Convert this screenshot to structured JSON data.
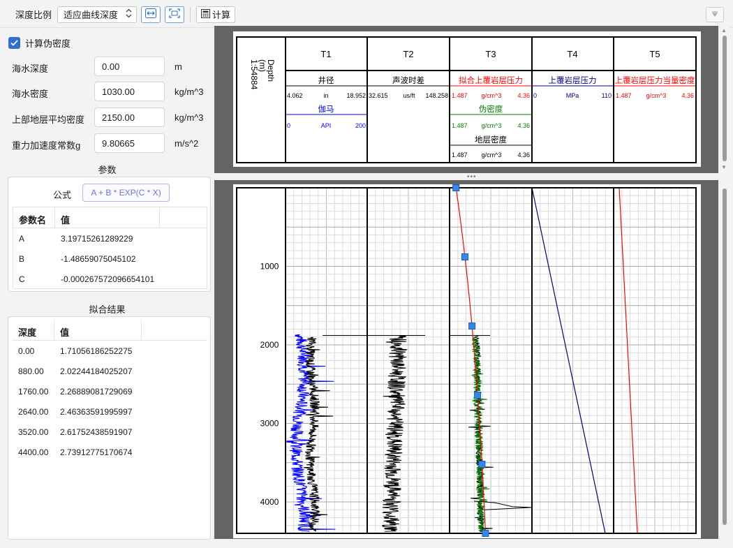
{
  "toolbar": {
    "depth_ratio_label": "深度比例",
    "depth_mode_value": "适应曲线深度",
    "fit_width_icon": "fit-width-icon",
    "fit-all-icon": "fit-all-icon",
    "calc_label": "计算",
    "calc_icon": "calculator-icon",
    "collapse_icon": "triangle-down-icon"
  },
  "settings": {
    "calc_pseudo_density_label": "计算伪密度",
    "calc_pseudo_density_checked": true,
    "fields": [
      {
        "label": "海水深度",
        "value": "0.00",
        "unit": "m"
      },
      {
        "label": "海水密度",
        "value": "1030.00",
        "unit": "kg/m^3"
      },
      {
        "label": "上部地层平均密度",
        "value": "2150.00",
        "unit": "kg/m^3"
      },
      {
        "label": "重力加速度常数g",
        "value": "9.80665",
        "unit": "m/s^2"
      }
    ]
  },
  "params": {
    "section_title": "参数",
    "formula_label": "公式",
    "formula_value": "A + B * EXP(C * X)",
    "headers": [
      "参数名",
      "值"
    ],
    "rows": [
      {
        "name": "A",
        "value": "3.19715261289229"
      },
      {
        "name": "B",
        "value": "-1.48659075045102"
      },
      {
        "name": "C",
        "value": "-0.000267572096654101"
      }
    ]
  },
  "fit": {
    "section_title": "拟合结果",
    "headers": [
      "深度",
      "值"
    ],
    "rows": [
      {
        "depth": "0.00",
        "value": "1.71056186252275"
      },
      {
        "depth": "880.00",
        "value": "2.02244184025207"
      },
      {
        "depth": "1760.00",
        "value": "2.26889081729069"
      },
      {
        "depth": "2640.00",
        "value": "2.46363591995997"
      },
      {
        "depth": "3520.00",
        "value": "2.61752438591907"
      },
      {
        "depth": "4400.00",
        "value": "2.73912775170674"
      }
    ]
  },
  "header": {
    "depth_title": "Depth",
    "depth_unit": "(m)",
    "depth_scale": "1:54884",
    "tracks": [
      "T1",
      "T2",
      "T3",
      "T4",
      "T5"
    ],
    "curves": {
      "caliper": {
        "name": "井径",
        "min": "4.062",
        "unit": "in",
        "max": "18.952",
        "color": "#000000"
      },
      "gamma": {
        "name": "伽马",
        "min": "0",
        "unit": "API",
        "max": "200",
        "color": "#0000ff"
      },
      "sonic": {
        "name": "声波时差",
        "min": "32.615",
        "unit": "us/ft",
        "max": "148.258",
        "color": "#000000"
      },
      "fit_pressure": {
        "name": "拟合上覆岩层压力",
        "min": "1.487",
        "unit": "g/cm^3",
        "max": "4.36",
        "color": "#ff0000"
      },
      "pseudo_density": {
        "name": "伪密度",
        "min": "1.487",
        "unit": "g/cm^3",
        "max": "4.36",
        "color": "#008000"
      },
      "formation_density": {
        "name": "地层密度",
        "min": "1.487",
        "unit": "g/cm^3",
        "max": "4.36",
        "color": "#000000"
      },
      "overburden_pressure": {
        "name": "上覆岩层压力",
        "min": "0",
        "unit": "MPa",
        "max": "110",
        "color": "#000080"
      },
      "overburden_density": {
        "name": "上覆岩层压力当量密度",
        "min": "1.487",
        "unit": "g/cm^3",
        "max": "4.36",
        "color": "#ff0000"
      }
    }
  },
  "log": {
    "depth_labels": [
      "1000",
      "2000",
      "3000",
      "4000"
    ],
    "control_point_depths": [
      0,
      880,
      1760,
      2640,
      3520,
      4400
    ]
  },
  "colors": {
    "control_point": "#3388ee",
    "panel_bg": "#646464",
    "grid_minor": "#d8d8d8",
    "grid_major": "#b0b0b0"
  }
}
